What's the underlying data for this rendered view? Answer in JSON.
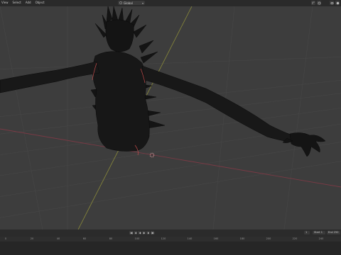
{
  "header": {
    "menu": [
      "View",
      "Select",
      "Add",
      "Object"
    ],
    "mode_label": "Global",
    "icons": [
      "cursor-icon",
      "move-icon",
      "snap-icon",
      "proportional-icon",
      "overlay-icon",
      "shading-icon"
    ]
  },
  "viewport": {
    "background": "#3d3d3d",
    "grid_color": "#474747",
    "x_axis_color": "#7a3a45",
    "y_axis_color": "#8a8a3a",
    "mesh_color": "#0d0d0d",
    "seam_color": "#c04a4a"
  },
  "timeline": {
    "transport_icons": [
      "jump-start-icon",
      "prev-key-icon",
      "play-reverse-icon",
      "play-icon",
      "next-key-icon",
      "jump-end-icon"
    ],
    "current_frame": "1",
    "start_label": "Start",
    "start_value": "1",
    "end_label": "End",
    "end_value": "250",
    "ticks": [
      "0",
      "20",
      "40",
      "60",
      "80",
      "100",
      "120",
      "140",
      "160",
      "180",
      "200",
      "220",
      "240"
    ]
  }
}
